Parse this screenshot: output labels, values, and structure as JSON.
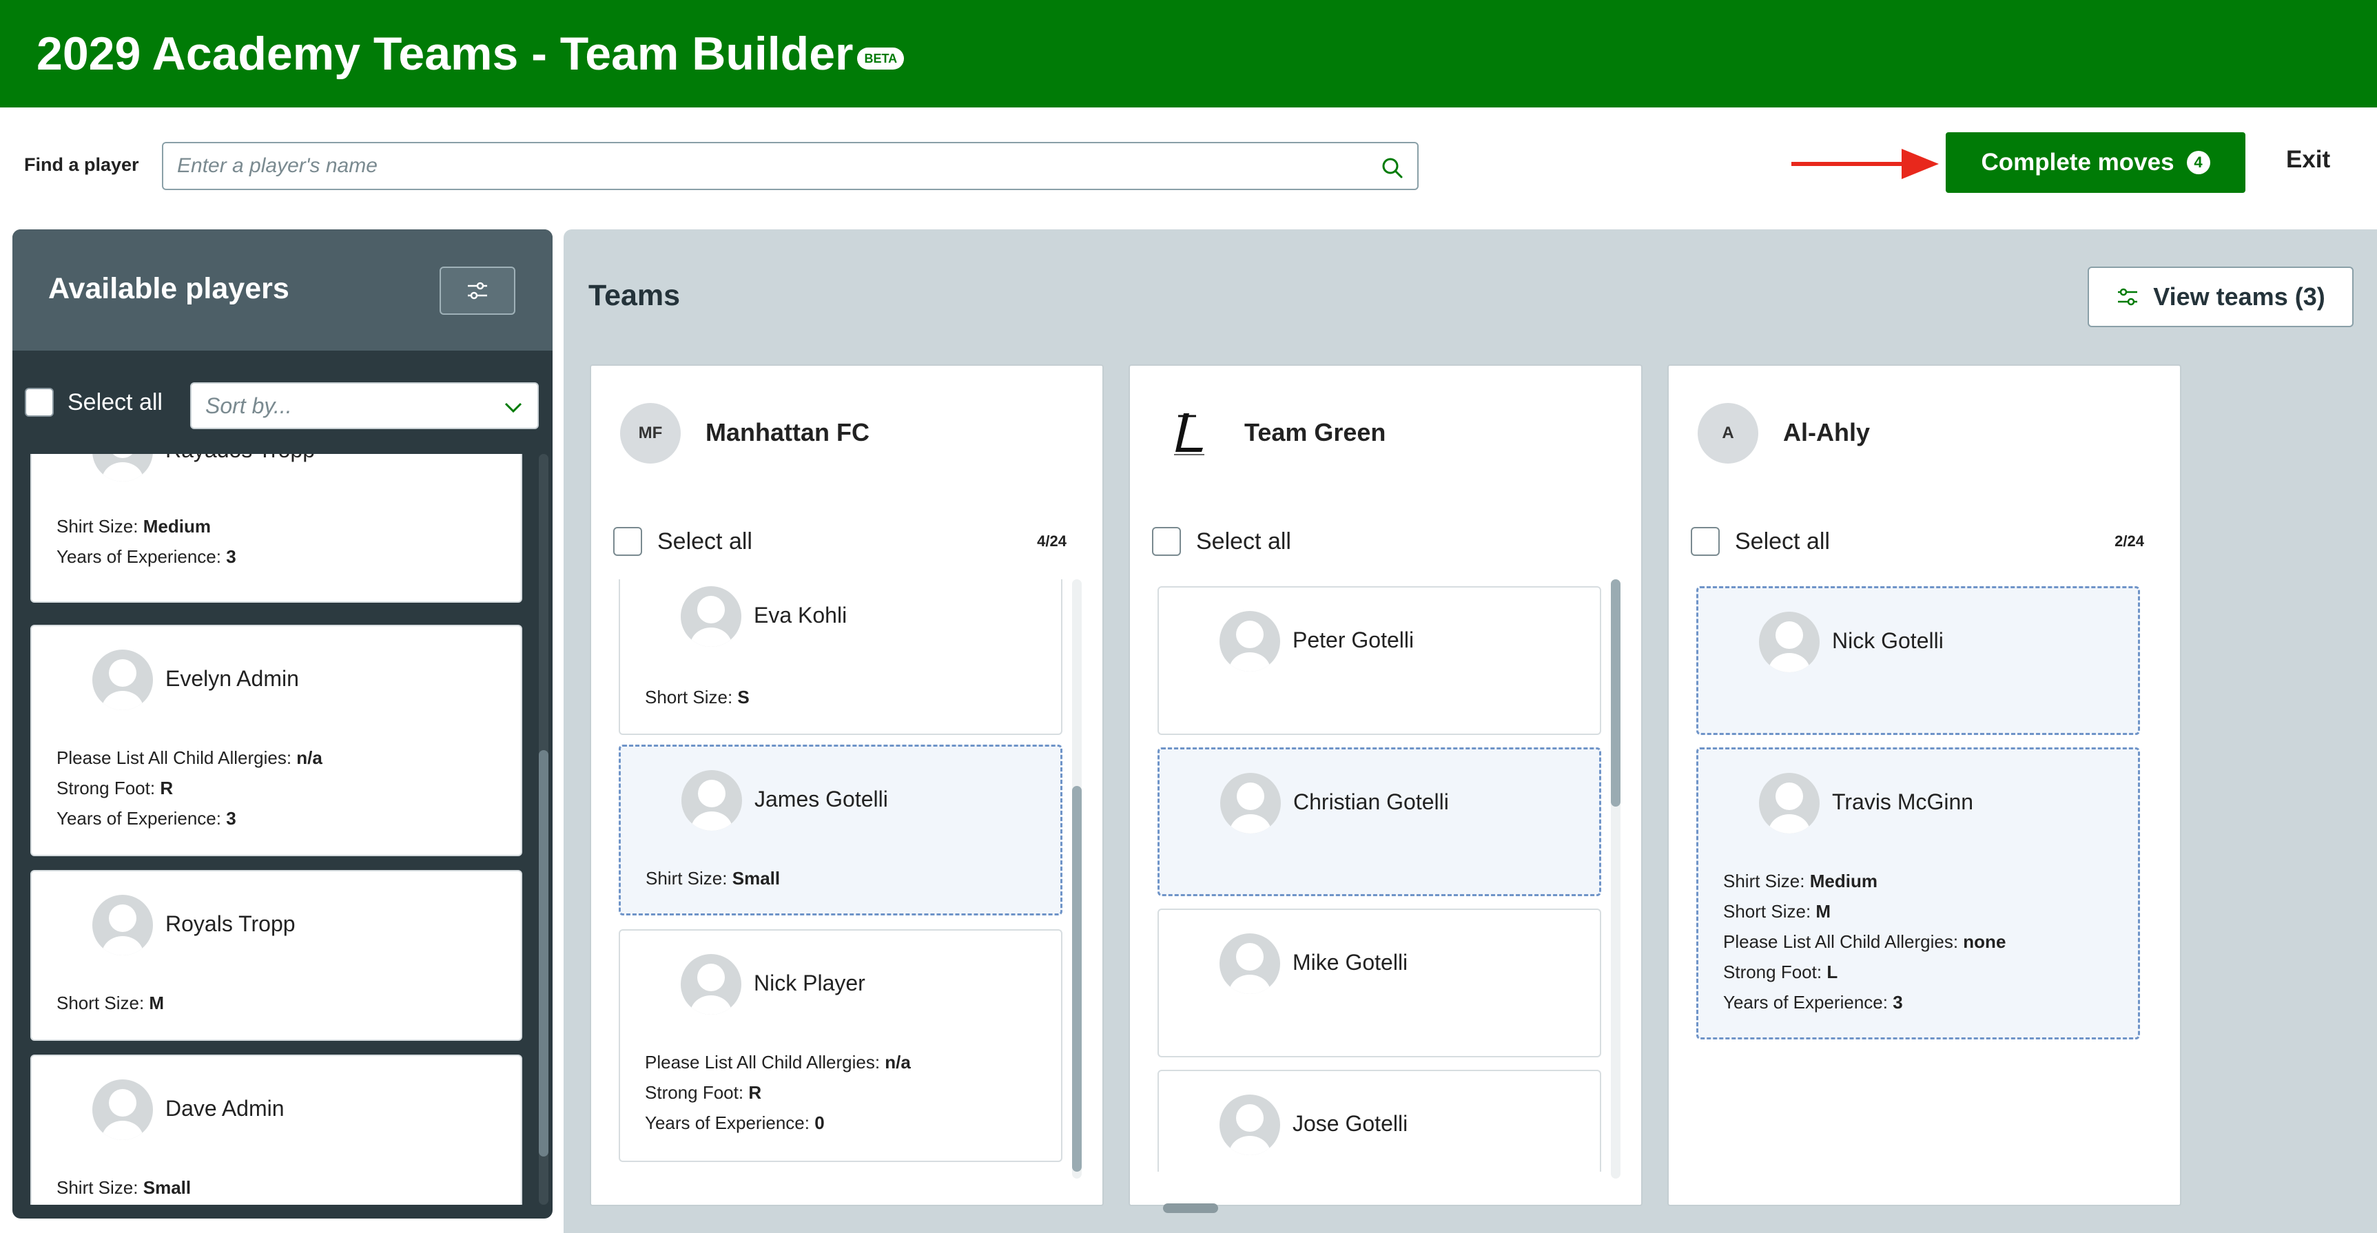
{
  "header": {
    "title": "2029 Academy Teams - Team Builder",
    "badge": "BETA"
  },
  "topbar": {
    "find_label": "Find a player",
    "search_placeholder": "Enter a player's name",
    "complete_label": "Complete moves",
    "complete_count": "4",
    "exit_label": "Exit"
  },
  "available": {
    "title": "Available players",
    "select_all": "Select all",
    "sort_placeholder": "Sort by...",
    "cards": [
      {
        "name": "Rayados Tropp",
        "attrs": [
          {
            "k": "Shirt Size:",
            "v": "Medium"
          },
          {
            "k": "Years of Experience:",
            "v": "3"
          }
        ]
      },
      {
        "name": "Evelyn Admin",
        "attrs": [
          {
            "k": "Please List All Child Allergies:",
            "v": "n/a"
          },
          {
            "k": "Strong Foot:",
            "v": "R"
          },
          {
            "k": "Years of Experience:",
            "v": "3"
          }
        ]
      },
      {
        "name": "Royals Tropp",
        "attrs": [
          {
            "k": "Short Size:",
            "v": "M"
          }
        ]
      },
      {
        "name": "Dave Admin",
        "attrs": [
          {
            "k": "Shirt Size:",
            "v": "Small"
          }
        ]
      }
    ]
  },
  "teams_panel": {
    "title": "Teams",
    "view_label": "View teams (3)",
    "teams": [
      {
        "initials": "MF",
        "name": "Manhattan FC",
        "select_all": "Select all",
        "count": "4/24",
        "cards": [
          {
            "name": "Eva Kohli",
            "attrs": [
              {
                "k": "Short Size:",
                "v": "S"
              }
            ]
          },
          {
            "name": "James Gotelli",
            "attrs": [
              {
                "k": "Shirt Size:",
                "v": "Small"
              }
            ]
          },
          {
            "name": "Nick Player",
            "attrs": [
              {
                "k": "Please List All Child Allergies:",
                "v": "n/a"
              },
              {
                "k": "Strong Foot:",
                "v": "R"
              },
              {
                "k": "Years of Experience:",
                "v": "0"
              }
            ]
          }
        ]
      },
      {
        "initials": "",
        "name": "Team Green",
        "select_all": "Select all",
        "count": "",
        "cards": [
          {
            "name": "Peter Gotelli",
            "attrs": []
          },
          {
            "name": "Christian Gotelli",
            "attrs": []
          },
          {
            "name": "Mike Gotelli",
            "attrs": []
          },
          {
            "name": "Jose Gotelli",
            "attrs": []
          }
        ]
      },
      {
        "initials": "A",
        "name": "Al-Ahly",
        "select_all": "Select all",
        "count": "2/24",
        "cards": [
          {
            "name": "Nick Gotelli",
            "attrs": []
          },
          {
            "name": "Travis McGinn",
            "attrs": [
              {
                "k": "Shirt Size:",
                "v": "Medium"
              },
              {
                "k": "Short Size:",
                "v": "M"
              },
              {
                "k": "Please List All Child Allergies:",
                "v": "none"
              },
              {
                "k": "Strong Foot:",
                "v": "L"
              },
              {
                "k": "Years of Experience:",
                "v": "3"
              }
            ]
          }
        ]
      }
    ]
  },
  "colors": {
    "brand_green": "#007b06",
    "panel_dark": "#2c3a40",
    "teams_bg": "#ccd6da",
    "arrow_red": "#e8281c",
    "pending_border": "#6f94c8"
  },
  "icons": [
    "search-icon",
    "filter-sliders-icon",
    "chevron-down-icon",
    "avatar-placeholder-icon",
    "team-green-logo-icon",
    "red-arrow-icon"
  ]
}
